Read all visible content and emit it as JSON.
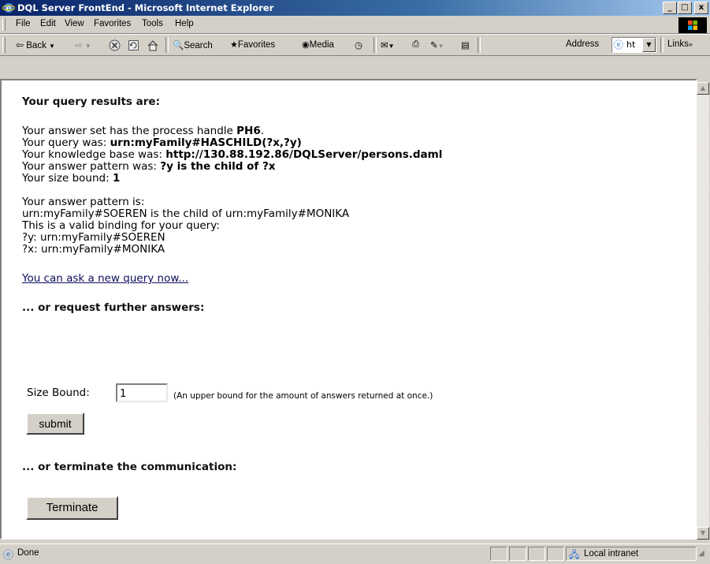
{
  "window": {
    "title": "DQL Server FrontEnd - Microsoft Internet Explorer",
    "min": "_",
    "max": "□",
    "close": "x"
  },
  "menu": {
    "items": [
      "File",
      "Edit",
      "View",
      "Favorites",
      "Tools",
      "Help"
    ]
  },
  "toolbar": {
    "back": "Back",
    "search": "Search",
    "favorites": "Favorites",
    "media": "Media",
    "address_label": "Address",
    "address_value": "ht",
    "links": "Links"
  },
  "page": {
    "heading": "Your query results are:",
    "process_prefix": "Your answer set has the process handle ",
    "process_handle": "PH6",
    "process_suffix": ".",
    "query_prefix": "Your query was: ",
    "query_value": "urn:myFamily#HASCHILD(?x,?y)",
    "kb_prefix": "Your knowledge base was: ",
    "kb_value": "http://130.88.192.86/DQLServer/persons.daml",
    "pattern_prefix": "Your answer pattern was: ",
    "pattern_value": "?y is the child of ?x",
    "size_prefix": "Your size bound: ",
    "size_value": "1",
    "answer_lines": [
      "Your answer pattern is:",
      "urn:myFamily#SOEREN is the child of urn:myFamily#MONIKA",
      "This is a valid binding for your query:",
      "?y: urn:myFamily#SOEREN",
      "?x: urn:myFamily#MONIKA"
    ],
    "new_query_link": "You can ask a new query now...",
    "further_heading": "... or request further answers:",
    "size_bound_label": "Size Bound:",
    "size_bound_value": "1",
    "size_bound_hint": "(An upper bound for the amount of answers returned at once.)",
    "submit_label": "submit",
    "terminate_heading": "... or terminate the communication:",
    "terminate_label": "Terminate"
  },
  "status": {
    "text": "Done",
    "zone": "Local intranet"
  }
}
